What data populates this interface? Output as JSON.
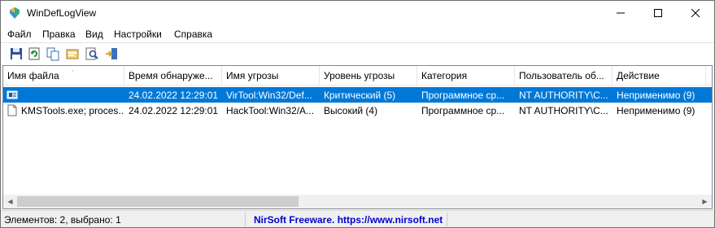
{
  "window": {
    "title": "WinDefLogView",
    "controls": {
      "minimize": "—",
      "maximize": "☐",
      "close": "✕"
    }
  },
  "menu": {
    "items": [
      "Файл",
      "Правка",
      "Вид",
      "Настройки",
      "Справка"
    ]
  },
  "toolbar": {
    "buttons": [
      "save-icon",
      "refresh-icon",
      "copy-icon",
      "properties-icon",
      "find-icon",
      "exit-icon"
    ]
  },
  "table": {
    "columns": [
      "Имя файла",
      "Время обнаруже...",
      "Имя угрозы",
      "Уровень угрозы",
      "Категория",
      "Пользователь об...",
      "Действие"
    ],
    "sort_indicator": "ˊ",
    "rows": [
      {
        "selected": true,
        "file": "",
        "time": "24.02.2022 12:29:01",
        "threat": "VirTool:Win32/Def...",
        "level": "Критический (5)",
        "category": "Программное ср...",
        "user": "NT AUTHORITY\\С...",
        "action": "Неприменимо (9)"
      },
      {
        "selected": false,
        "file": "KMSTools.exe; proces...",
        "time": "24.02.2022 12:29:01",
        "threat": "HackTool:Win32/A...",
        "level": "Высокий (4)",
        "category": "Программное ср...",
        "user": "NT AUTHORITY\\С...",
        "action": "Неприменимо (9)"
      }
    ]
  },
  "scrollbar": {
    "left_arrow": "◀",
    "right_arrow": "▶"
  },
  "status": {
    "summary": "Элементов: 2, выбрано: 1",
    "link": "NirSoft Freeware. https://www.nirsoft.net"
  },
  "colors": {
    "selection": "#0078d7",
    "link": "#0000d0"
  }
}
